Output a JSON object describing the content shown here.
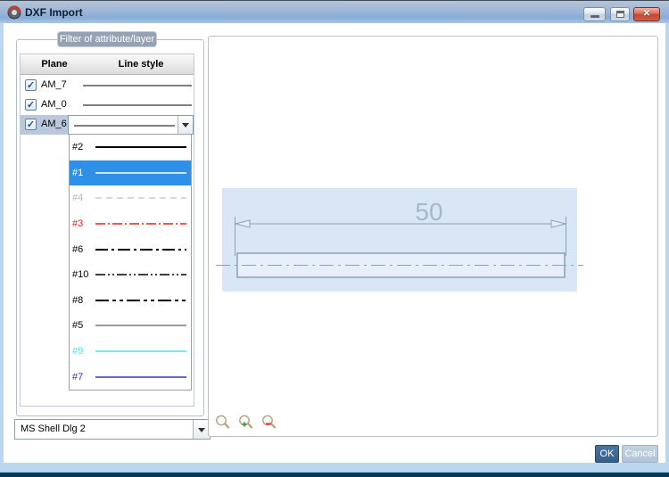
{
  "window": {
    "title": "DXF Import"
  },
  "titlebar": {
    "close_glyph": "✕"
  },
  "filter": {
    "label": "Filter of attribute/layer",
    "columns": {
      "plane": "Plane",
      "line_style": "Line style"
    },
    "row_line_color": "#000000",
    "rows": [
      {
        "name": "AM_7",
        "checked": true,
        "check_glyph": "✓"
      },
      {
        "name": "AM_0",
        "checked": true,
        "check_glyph": "✓"
      },
      {
        "name": "AM_6",
        "checked": true,
        "check_glyph": "✓",
        "selected": true
      }
    ],
    "line_styles": [
      {
        "label": "#2",
        "color": "#000000",
        "dash": "",
        "width": "2",
        "label_style": "color:#000000"
      },
      {
        "label": "#1",
        "color": "#ffffff",
        "dash": "",
        "width": "1.5",
        "label_style": "color:#ffffff",
        "selected": true
      },
      {
        "label": "#4",
        "color": "#c9c9c9",
        "dash": "7,5",
        "width": "1.5",
        "label_style": "color:#b4b4b4"
      },
      {
        "label": "#3",
        "color": "#e02424",
        "dash": "11,3,2,3",
        "width": "1.5",
        "label_style": "color:#e02424"
      },
      {
        "label": "#6",
        "color": "#000000",
        "dash": "14,4,3,4",
        "width": "2",
        "label_style": "color:#000000"
      },
      {
        "label": "#10",
        "color": "#000000",
        "dash": "11,3,2,3,2,3",
        "width": "1.5",
        "label_style": "color:#000000"
      },
      {
        "label": "#8",
        "color": "#000000",
        "dash": "15,4,4,4,4,4",
        "width": "2",
        "label_style": "color:#000000"
      },
      {
        "label": "#5",
        "color": "#3a3a3a",
        "dash": "",
        "width": "1",
        "label_style": "color:#000000"
      },
      {
        "label": "#9",
        "color": "#3fe8e8",
        "dash": "",
        "width": "1.5",
        "label_style": "color:#3fe8e8"
      },
      {
        "label": "#7",
        "color": "#3333cc",
        "dash": "",
        "width": "1.5",
        "label_style": "color:#3333cc"
      }
    ]
  },
  "font_combo": {
    "value": "MS Shell Dlg 2"
  },
  "preview": {
    "dimension_text": "50",
    "highlight_color": "#d9e6f5",
    "draw_color": "#8da0b6",
    "dim_text_color": "#a7b8cc"
  },
  "footer": {
    "ok_label": "OK",
    "cancel_label": "Cancel"
  },
  "colors": {
    "selection_blue": "#2e90e8",
    "row_highlight": "#b9c8da",
    "ok_button": "#35608c"
  }
}
